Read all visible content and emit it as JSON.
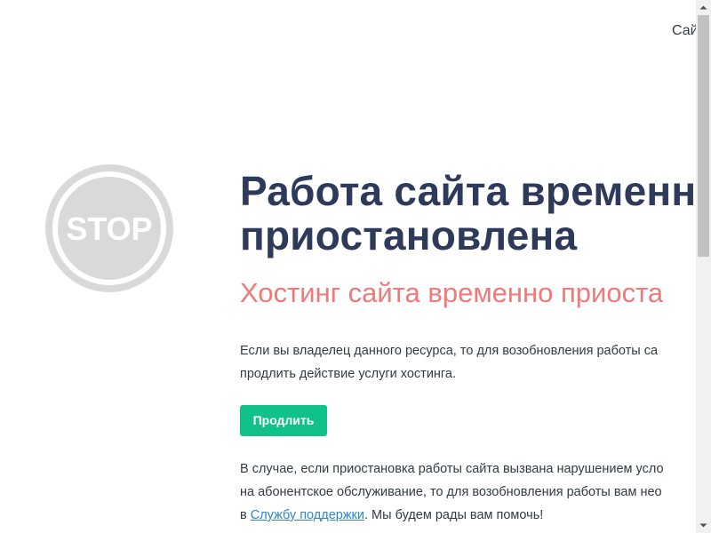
{
  "header": {
    "top_link": "Сай"
  },
  "stop_sign": {
    "text": "STOP",
    "color": "#d9d9d9"
  },
  "main": {
    "title_line1": "Работа сайта временн",
    "title_line2": "приостановлена",
    "subtitle": "Хостинг сайта временно приоста",
    "paragraph1_line1": "Если вы владелец данного ресурса, то для возобновления работы са",
    "paragraph1_line2": "продлить действие услуги хостинга.",
    "renew_button": "Продлить",
    "paragraph2_line1": "В случае, если приостановка работы сайта вызвана нарушением усло",
    "paragraph2_line2": "на абонентское обслуживание, то для возобновления работы вам нео",
    "paragraph2_line3_prefix": "в ",
    "support_link": "Службу поддержки",
    "paragraph2_line3_suffix": ". Мы будем рады вам помочь!"
  },
  "colors": {
    "title": "#2e3a59",
    "subtitle": "#f07a7a",
    "button": "#10c28a",
    "link": "#2f86c8",
    "text": "#333a44"
  },
  "scrollbar": {
    "position": 0
  }
}
